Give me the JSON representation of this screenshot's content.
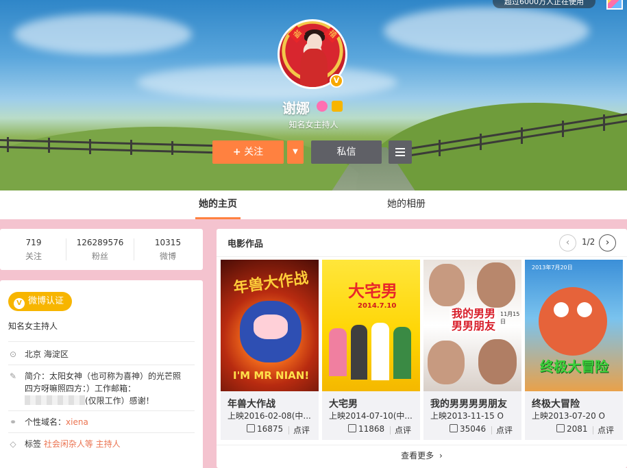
{
  "cover": {
    "promo_text": "超过6000万人正在使用"
  },
  "profile": {
    "name": "谢娜",
    "intro": "知名女主持人",
    "verified_badge": "V",
    "follow_label": "关注",
    "follow_icon": "+",
    "dropdown_icon": "▼",
    "message_label": "私信"
  },
  "tabs": [
    {
      "label": "她的主页",
      "active": true
    },
    {
      "label": "她的相册",
      "active": false
    }
  ],
  "stats": [
    {
      "value": "719",
      "label": "关注"
    },
    {
      "value": "126289576",
      "label": "粉丝"
    },
    {
      "value": "10315",
      "label": "微博"
    }
  ],
  "info": {
    "verify_label": "微博认证",
    "verify_title": "知名女主持人",
    "location": "北京 海淀区",
    "bio_line1": "简介：太阳女神（也可称为喜神）的光芒照",
    "bio_line2": "四方呀嘛照四方：）工作邮箱：",
    "bio_line3_suffix": "(仅限工作）感谢！",
    "domain_label": "个性域名：",
    "domain_value": "xiena",
    "tags_label": "标签",
    "tags_value": "社会闲杂人等 主持人"
  },
  "movies": {
    "section_title": "电影作品",
    "pager": "1/2",
    "prev_icon": "‹",
    "next_icon": "›",
    "more_label": "查看更多",
    "items": [
      {
        "title": "年兽大作战",
        "date": "上映2016-02-08(中...",
        "likes": "16875",
        "rate": "点评",
        "poster_text": "年兽大作战",
        "poster_sub": "I'M MR NIAN!"
      },
      {
        "title": "大宅男",
        "date": "上映2014-07-10(中...",
        "likes": "11868",
        "rate": "点评",
        "poster_text": "大宅男",
        "poster_sub": "2014.7.10"
      },
      {
        "title": "我的男男男男朋友",
        "date": "上映2013-11-15 O",
        "likes": "35046",
        "rate": "点评",
        "poster_text": "我的男男男男朋友",
        "poster_sub": "11月15日"
      },
      {
        "title": "终极大冒险",
        "date": "上映2013-07-20 O",
        "likes": "2081",
        "rate": "点评",
        "poster_text": "终极大冒险",
        "poster_sub": "2013年7月20日"
      }
    ]
  }
}
